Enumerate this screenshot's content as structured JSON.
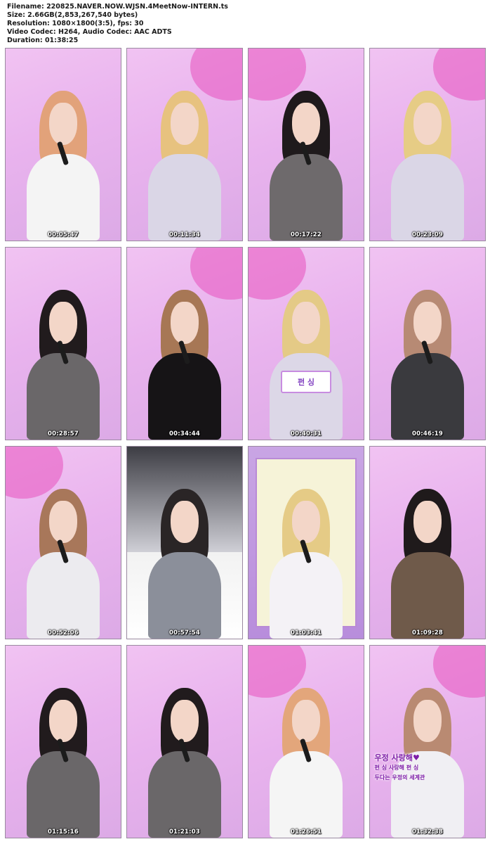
{
  "header": {
    "filename": "Filename: 220825.NAVER.NOW.WJSN.4MeetNow-INTERN.ts",
    "size": "Size: 2.66GB(2,853,267,540 bytes)",
    "resolution": "Resolution: 1080×1800(3:5), fps: 30",
    "codecs": "Video Codec: H264, Audio Codec: AAC ADTS",
    "duration": "Duration: 01:38:25"
  },
  "thumbnails": [
    {
      "timestamp": "00:05:47",
      "hair": "#e2a27a",
      "outfit": "#f4f4f4",
      "blob": false,
      "mic": true
    },
    {
      "timestamp": "00:11:34",
      "hair": "#e7c27f",
      "outfit": "#dad6e6",
      "blob": true,
      "mic": false
    },
    {
      "timestamp": "00:17:22",
      "hair": "#1f1a1c",
      "outfit": "#6e6a6c",
      "blob": true,
      "mic": true
    },
    {
      "timestamp": "00:23:09",
      "hair": "#e6cc85",
      "outfit": "#dad6e6",
      "blob": true,
      "mic": false
    },
    {
      "timestamp": "00:28:57",
      "hair": "#211b1d",
      "outfit": "#6a6769",
      "blob": false,
      "mic": true
    },
    {
      "timestamp": "00:34:44",
      "hair": "#a77755",
      "outfit": "#161416",
      "blob": true,
      "mic": true
    },
    {
      "timestamp": "00:40:31",
      "hair": "#e4ca86",
      "outfit": "#dcd7e7",
      "blob": true,
      "mic": false
    },
    {
      "timestamp": "00:46:19",
      "hair": "#b78a74",
      "outfit": "#3a3a3e",
      "blob": false,
      "mic": true
    },
    {
      "timestamp": "00:52:06",
      "hair": "#a8775a",
      "outfit": "#ecebef",
      "blob": true,
      "mic": true
    },
    {
      "timestamp": "00:57:54",
      "hair": "#2a2526",
      "outfit": "#8b8f9a",
      "blob": false,
      "mic": false
    },
    {
      "timestamp": "01:03:41",
      "hair": "#e5cb86",
      "outfit": "#f4f2f6",
      "blob": false,
      "mic": true
    },
    {
      "timestamp": "01:09:28",
      "hair": "#1f1a1b",
      "outfit": "#6f5a4a",
      "blob": false,
      "mic": false
    },
    {
      "timestamp": "01:15:16",
      "hair": "#211b1d",
      "outfit": "#6a6769",
      "blob": false,
      "mic": true
    },
    {
      "timestamp": "01:21:03",
      "hair": "#211b1d",
      "outfit": "#6a6769",
      "blob": false,
      "mic": true
    },
    {
      "timestamp": "01:26:51",
      "hair": "#e3a67b",
      "outfit": "#f5f5f5",
      "blob": true,
      "mic": true
    },
    {
      "timestamp": "01:32:38",
      "hair": "#b98a72",
      "outfit": "#f0eff3",
      "blob": true,
      "mic": false
    }
  ],
  "captions": {
    "thumb7_caption": "펀 싱",
    "thumb16_caption_line1": "우정 사랑해♥",
    "thumb16_caption_line2": "펀 싱 사랑해 펀 싱",
    "thumb16_caption_line3": "두다는 우정의 세계관"
  },
  "colors": {
    "background_pink": "#eab6ee",
    "accent_magenta": "#e150be",
    "timestamp_text": "#ffffff"
  }
}
